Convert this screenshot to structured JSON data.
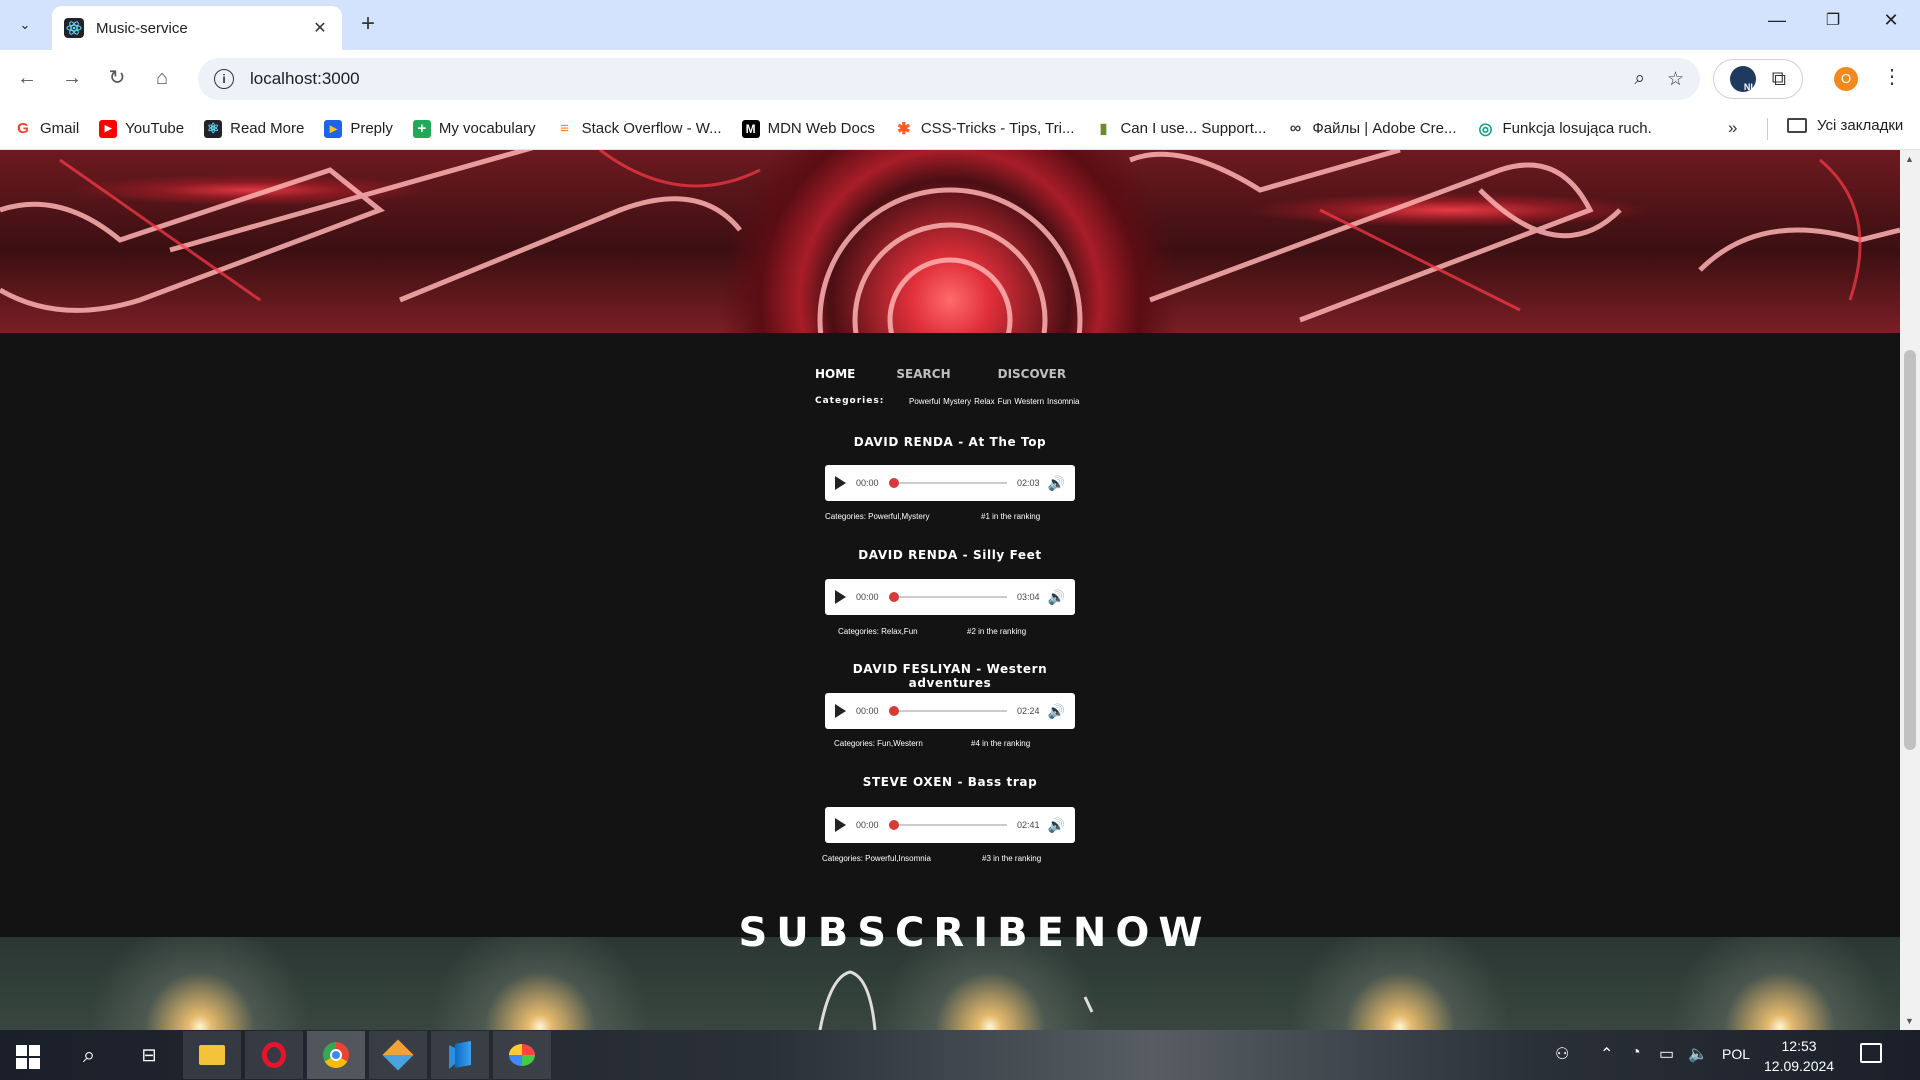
{
  "browser": {
    "tab_title": "Music-service",
    "url": "localhost:3000",
    "profile_initial": "O",
    "extension_label": "NL",
    "bookmarks": [
      {
        "label": "Gmail",
        "icon": "G",
        "color": "#ea4335"
      },
      {
        "label": "YouTube",
        "icon": "▶",
        "color": "#ff0000"
      },
      {
        "label": "Read More",
        "icon": "⚛",
        "color": "#20232a"
      },
      {
        "label": "Preply",
        "icon": "▸",
        "color": "#f5c518"
      },
      {
        "label": "My vocabulary",
        "icon": "+",
        "color": "#1faa59"
      },
      {
        "label": "Stack Overflow - W...",
        "icon": "≡",
        "color": "#f48024"
      },
      {
        "label": "MDN Web Docs",
        "icon": "M",
        "color": "#000000"
      },
      {
        "label": "CSS-Tricks - Tips, Tri...",
        "icon": "✱",
        "color": "#ff5a1f"
      },
      {
        "label": "Can I use... Support...",
        "icon": "▮",
        "color": "#6b8e23"
      },
      {
        "label": "Файлы | Adobe Cre...",
        "icon": "∞",
        "color": "#444444"
      },
      {
        "label": "Funkcja losująca ruch.",
        "icon": "◎",
        "color": "#10a37f"
      }
    ],
    "all_bookmarks_label": "Усі закладки"
  },
  "page": {
    "nav": {
      "home": "HOME",
      "search": "SEARCH",
      "discover": "DISCOVER"
    },
    "categories_label": "Categories:",
    "categories": [
      "Powerful",
      "Mystery",
      "Relax",
      "Fun",
      "Western",
      "Insomnia"
    ],
    "tracks": [
      {
        "title": "DAVID RENDA - At The Top",
        "current": "00:00",
        "duration": "02:03",
        "categories": "Categories: Powerful,Mystery",
        "ranking": "#1 in the ranking"
      },
      {
        "title": "DAVID RENDA - Silly Feet",
        "current": "00:00",
        "duration": "03:04",
        "categories": "Categories: Relax,Fun",
        "ranking": "#2 in the ranking"
      },
      {
        "title": "DAVID FESLIYAN - Western adventures",
        "current": "00:00",
        "duration": "02:24",
        "categories": "Categories: Fun,Western",
        "ranking": "#4 in the ranking"
      },
      {
        "title": "STEVE OXEN - Bass trap",
        "current": "00:00",
        "duration": "02:41",
        "categories": "Categories: Powerful,Insomnia",
        "ranking": "#3 in the ranking"
      }
    ],
    "subscribe": "SUBSCRIBENOW"
  },
  "taskbar": {
    "language": "POL",
    "time": "12:53",
    "date": "12.09.2024"
  },
  "colors": {
    "accent_thumb": "#d83a3a",
    "page_bg": "#131313",
    "tab_strip": "#d3e3fd"
  }
}
